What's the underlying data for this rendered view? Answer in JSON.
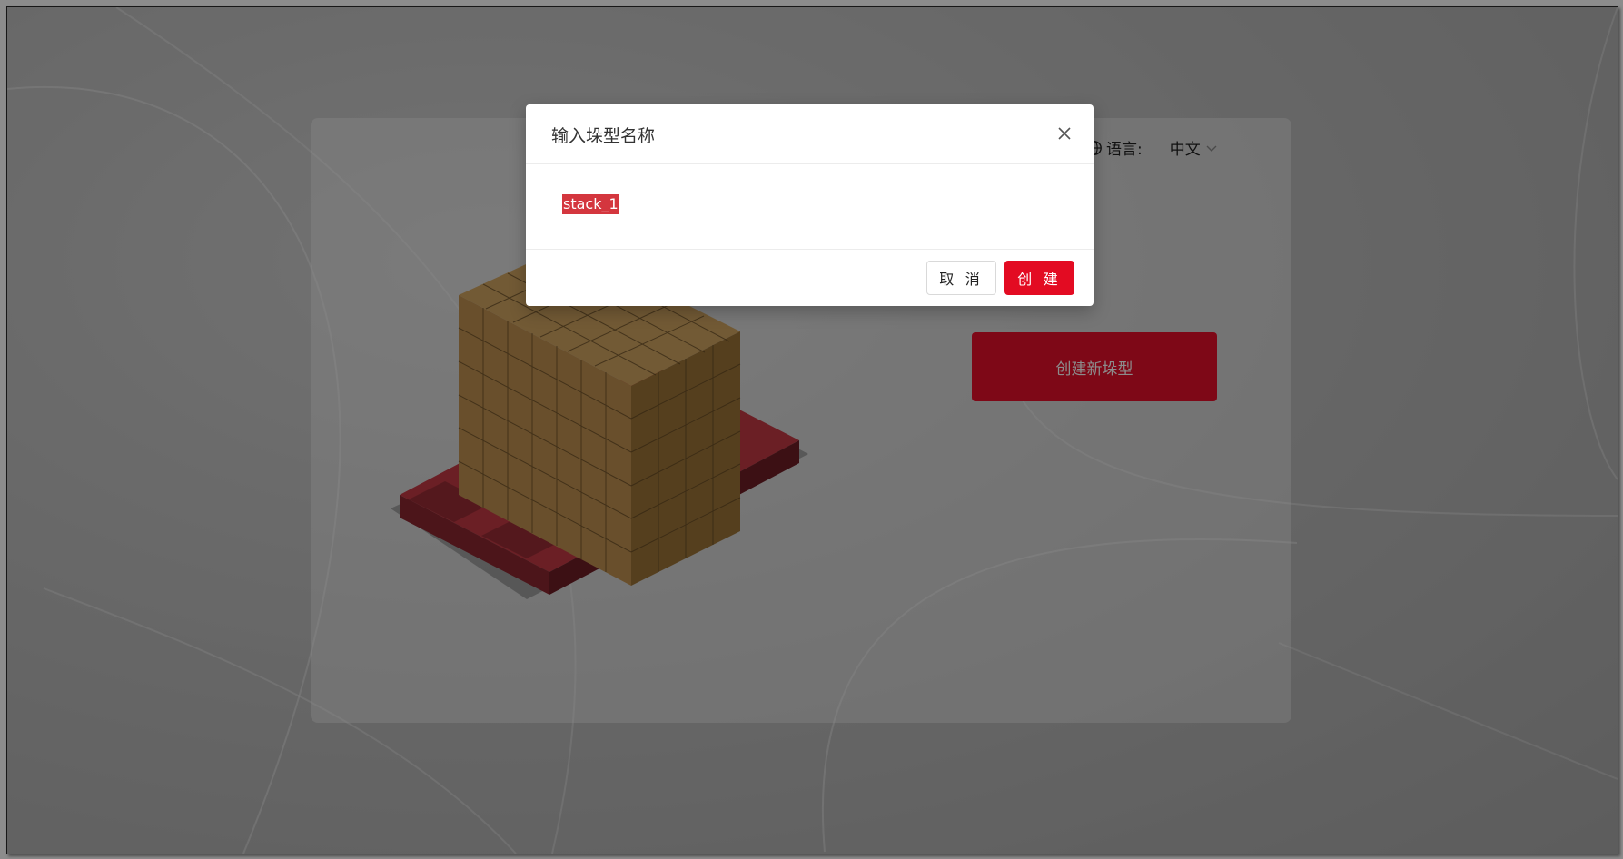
{
  "language": {
    "label": "语言:",
    "value": "中文"
  },
  "main": {
    "create_button_label": "创建新垛型"
  },
  "dialog": {
    "title": "输入垛型名称",
    "input_value": "stack_1",
    "cancel_label": "取 消",
    "confirm_label": "创 建"
  },
  "colors": {
    "accent": "#e30b22",
    "box": "#b48a4e",
    "pallet": "#a8343c"
  },
  "icons": {
    "language": "globe-icon",
    "dropdown": "chevron-down-icon",
    "close": "close-icon"
  }
}
